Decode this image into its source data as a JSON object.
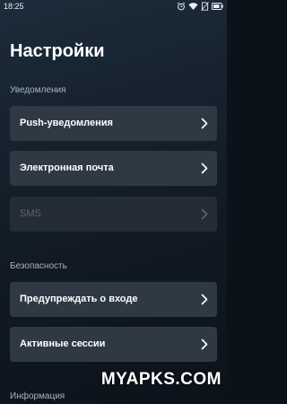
{
  "status_bar": {
    "time": "18:25",
    "icons": [
      "alarm-icon",
      "wifi-icon",
      "no-sim-icon",
      "battery-icon"
    ]
  },
  "page": {
    "title": "Настройки"
  },
  "sections": {
    "notifications": {
      "header": "Уведомления",
      "push": "Push-уведомления",
      "email": "Электронная почта",
      "sms": "SMS"
    },
    "security": {
      "header": "Безопасность",
      "login_warning": "Предупреждать о входе",
      "active_sessions": "Активные сессии"
    },
    "info": {
      "header": "Информация"
    }
  },
  "watermark": "MYAPKS.COM",
  "colors": {
    "background": "#16222e",
    "row": "#2f3944",
    "row_disabled": "#242d37",
    "section_header": "#aab3bd",
    "disabled_text": "#5c6671"
  }
}
